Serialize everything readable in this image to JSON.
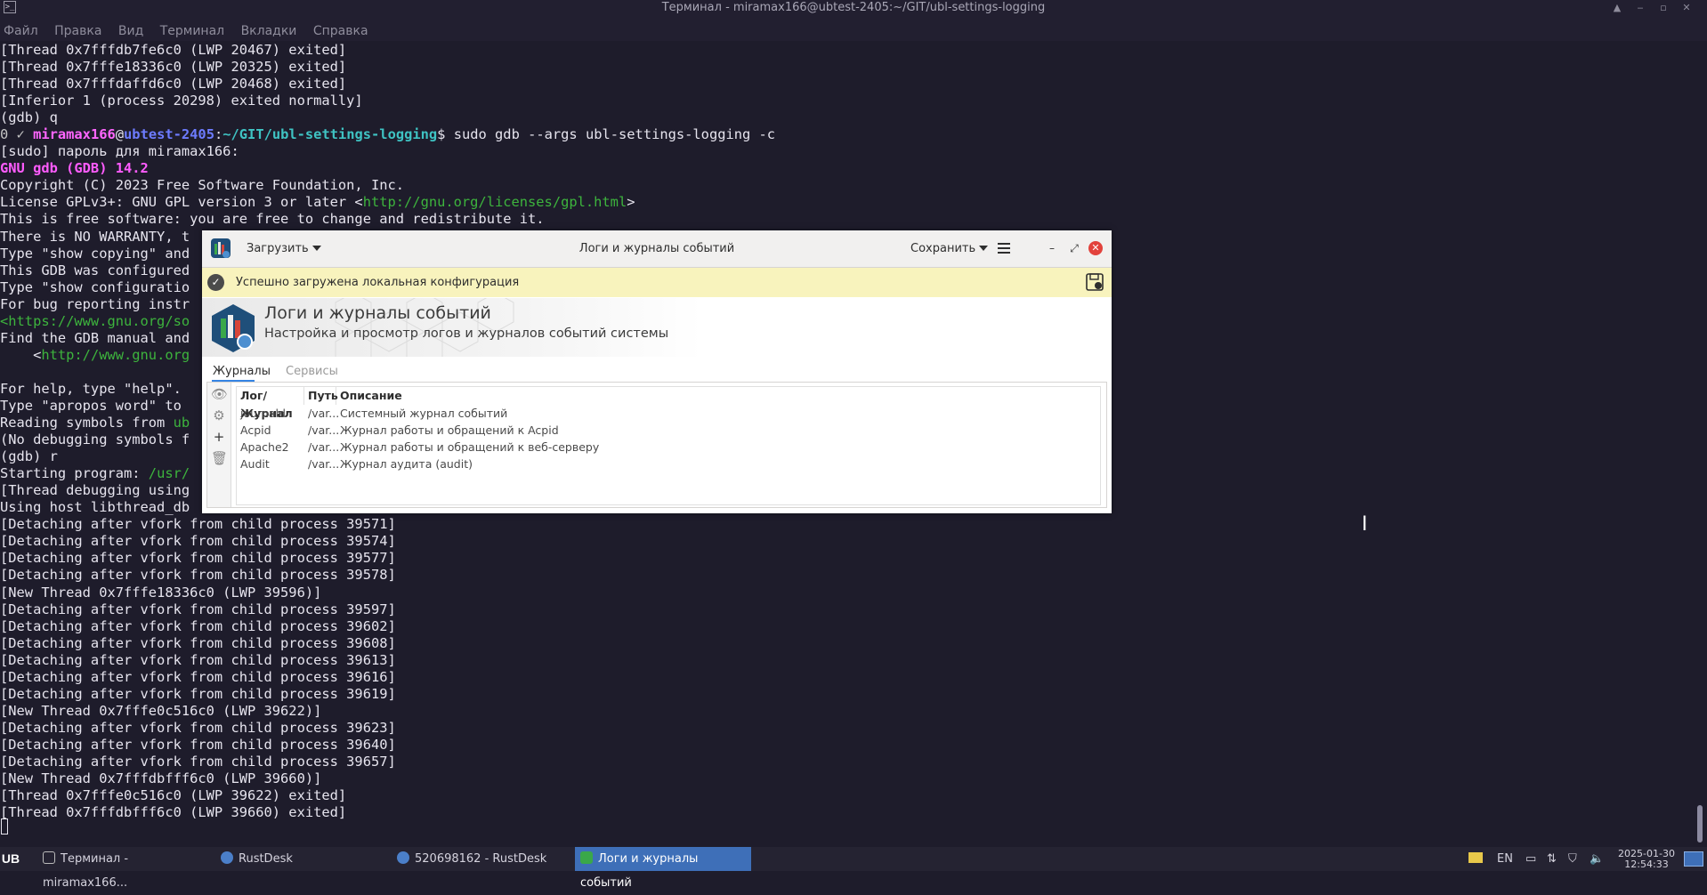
{
  "window": {
    "title": "Терминал - miramax166@ubtest-2405:~/GIT/ubl-settings-logging",
    "menu": [
      "Файл",
      "Правка",
      "Вид",
      "Терминал",
      "Вкладки",
      "Справка"
    ]
  },
  "terminal": {
    "lines": [
      [
        {
          "t": "[Thread 0x7fffdb7fe6c0 (LWP 20467) exited]"
        }
      ],
      [
        {
          "t": "[Thread 0x7fffe18336c0 (LWP 20325) exited]"
        }
      ],
      [
        {
          "t": "[Thread 0x7fffdaffd6c0 (LWP 20468) exited]"
        }
      ],
      [
        {
          "t": "[Inferior 1 (process 20298) exited normally]"
        }
      ],
      [
        {
          "t": "(gdb) q"
        }
      ],
      [
        {
          "t": "0 ✓ ",
          "c": "c-prompt"
        },
        {
          "t": "miramax166",
          "c": "c-user"
        },
        {
          "t": "@"
        },
        {
          "t": "ubtest-2405",
          "c": "c-host"
        },
        {
          "t": ":"
        },
        {
          "t": "~/GIT/ubl-settings-logging",
          "c": "c-path"
        },
        {
          "t": "$ sudo gdb --args ubl-settings-logging -c"
        }
      ],
      [
        {
          "t": "[sudo] пароль для miramax166:"
        }
      ],
      [
        {
          "t": "GNU gdb (GDB) 14.2",
          "c": "c-magenta"
        }
      ],
      [
        {
          "t": "Copyright (C) 2023 Free Software Foundation, Inc."
        }
      ],
      [
        {
          "t": "License GPLv3+: GNU GPL version 3 or later <"
        },
        {
          "t": "http://gnu.org/licenses/gpl.html",
          "c": "c-link"
        },
        {
          "t": ">"
        }
      ],
      [
        {
          "t": "This is free software: you are free to change and redistribute it."
        }
      ],
      [
        {
          "t": "There is NO WARRANTY, t"
        }
      ],
      [
        {
          "t": "Type \"show copying\" and"
        }
      ],
      [
        {
          "t": "This GDB was configured"
        }
      ],
      [
        {
          "t": "Type \"show configuratio"
        }
      ],
      [
        {
          "t": "For bug reporting instr"
        }
      ],
      [
        {
          "t": "<https://www.gnu.org/so",
          "c": "c-link"
        }
      ],
      [
        {
          "t": "Find the GDB manual and"
        }
      ],
      [
        {
          "t": "    <"
        },
        {
          "t": "http://www.gnu.org",
          "c": "c-link"
        }
      ],
      [
        {
          "t": ""
        }
      ],
      [
        {
          "t": "For help, type \"help\"."
        }
      ],
      [
        {
          "t": "Type \"apropos word\" to"
        }
      ],
      [
        {
          "t": "Reading symbols from "
        },
        {
          "t": "ub",
          "c": "c-link"
        }
      ],
      [
        {
          "t": "(No debugging symbols f"
        }
      ],
      [
        {
          "t": "(gdb) r"
        }
      ],
      [
        {
          "t": "Starting program: "
        },
        {
          "t": "/usr/",
          "c": "c-link"
        }
      ],
      [
        {
          "t": "[Thread debugging using"
        }
      ],
      [
        {
          "t": "Using host libthread_db"
        }
      ],
      [
        {
          "t": "[Detaching after vfork from child process 39571]"
        }
      ],
      [
        {
          "t": "[Detaching after vfork from child process 39574]"
        }
      ],
      [
        {
          "t": "[Detaching after vfork from child process 39577]"
        }
      ],
      [
        {
          "t": "[Detaching after vfork from child process 39578]"
        }
      ],
      [
        {
          "t": "[New Thread 0x7fffe18336c0 (LWP 39596)]"
        }
      ],
      [
        {
          "t": "[Detaching after vfork from child process 39597]"
        }
      ],
      [
        {
          "t": "[Detaching after vfork from child process 39602]"
        }
      ],
      [
        {
          "t": "[Detaching after vfork from child process 39608]"
        }
      ],
      [
        {
          "t": "[Detaching after vfork from child process 39613]"
        }
      ],
      [
        {
          "t": "[Detaching after vfork from child process 39616]"
        }
      ],
      [
        {
          "t": "[Detaching after vfork from child process 39619]"
        }
      ],
      [
        {
          "t": "[New Thread 0x7fffe0c516c0 (LWP 39622)]"
        }
      ],
      [
        {
          "t": "[Detaching after vfork from child process 39623]"
        }
      ],
      [
        {
          "t": "[Detaching after vfork from child process 39640]"
        }
      ],
      [
        {
          "t": "[Detaching after vfork from child process 39657]"
        }
      ],
      [
        {
          "t": "[New Thread 0x7fffdbfff6c0 (LWP 39660)]"
        }
      ],
      [
        {
          "t": "[Thread 0x7fffe0c516c0 (LWP 39622) exited]"
        }
      ],
      [
        {
          "t": "[Thread 0x7fffdbfff6c0 (LWP 39660) exited]"
        }
      ]
    ]
  },
  "dialog": {
    "load_label": "Загрузить",
    "title": "Логи и журналы событий",
    "save_label": "Сохранить",
    "info_message": "Успешно загружена локальная конфигурация",
    "banner_title": "Логи и журналы событий",
    "banner_subtitle": "Настройка и просмотр логов и журналов событий системы",
    "tabs": [
      {
        "label": "Журналы",
        "active": true
      },
      {
        "label": "Сервисы",
        "active": false
      }
    ],
    "columns": [
      "Лог/Журнал",
      "Путь",
      "Описание"
    ],
    "rows": [
      {
        "name": "journald",
        "path": "/var...",
        "desc": "Системный журнал событий"
      },
      {
        "name": "Acpid",
        "path": "/var...",
        "desc": "Журнал работы и обращений к Acpid"
      },
      {
        "name": "Apache2",
        "path": "/var...",
        "desc": "Журнал работы и обращений к веб-серверу"
      },
      {
        "name": "Audit",
        "path": "/var...",
        "desc": "Журнал аудита (audit)"
      }
    ],
    "side_icons": [
      "eye-icon",
      "gear-icon",
      "plus-icon",
      "trash-icon"
    ]
  },
  "taskbar": {
    "start_label": "UB",
    "items": [
      {
        "label": "Терминал - miramax166...",
        "icon": "terminal-icon",
        "active": false
      },
      {
        "label": "RustDesk",
        "icon": "rustdesk-icon",
        "active": false
      },
      {
        "label": "520698162 - RustDesk",
        "icon": "rustdesk-icon",
        "active": false
      },
      {
        "label": "Логи и журналы событий",
        "icon": "logs-icon",
        "active": true
      }
    ],
    "lang": "EN",
    "date": "2025-01-30",
    "time": "12:54:33"
  },
  "colors": {
    "terminal_bg": "#1e1c2b",
    "info_bar": "#f8f3bd",
    "taskbar_active": "#3e6fb8",
    "close_red": "#e2423c"
  }
}
